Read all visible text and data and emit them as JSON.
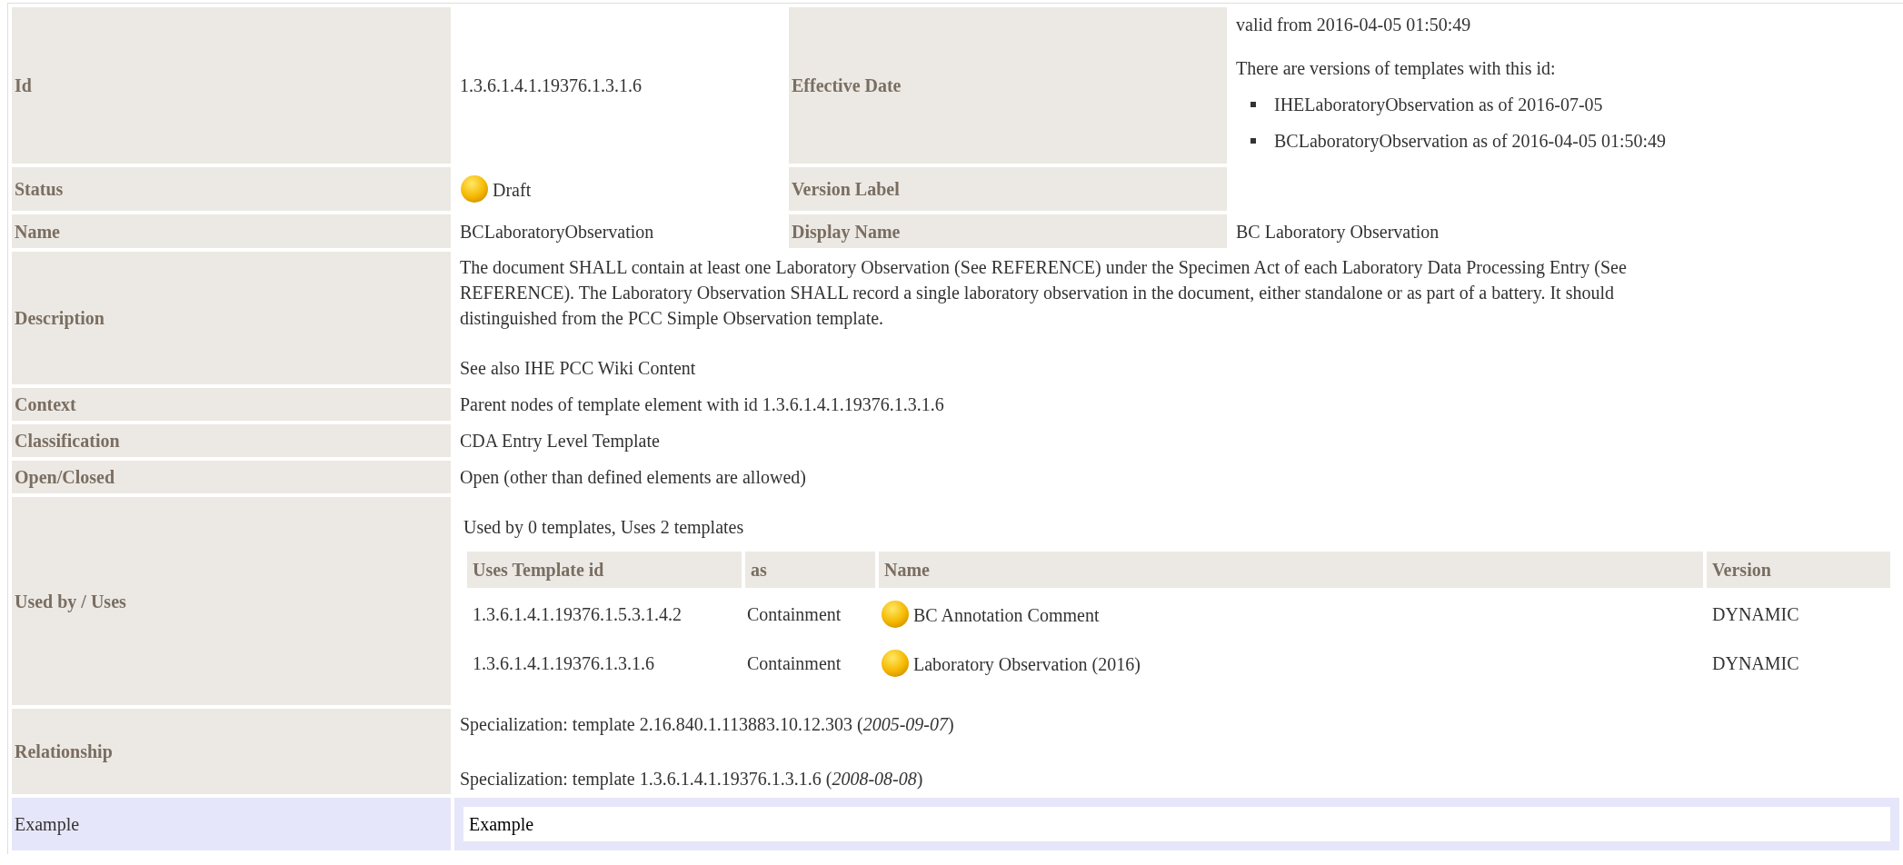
{
  "id": {
    "label": "Id",
    "value": "1.3.6.1.4.1.19376.1.3.1.6"
  },
  "effective_date": {
    "label": "Effective Date",
    "valid_from": "valid from 2016-04-05 01:50:49",
    "versions_intro": "There are versions of templates with this id:",
    "versions": [
      "IHELaboratoryObservation as of 2016-07-05",
      "BCLaboratoryObservation as of 2016-04-05 01:50:49"
    ]
  },
  "status": {
    "label": "Status",
    "value": "Draft",
    "kind": "draft"
  },
  "version_label": {
    "label": "Version Label"
  },
  "name": {
    "label": "Name",
    "value": "BCLaboratoryObservation"
  },
  "display_name": {
    "label": "Display Name",
    "value": "BC Laboratory Observation"
  },
  "description": {
    "label": "Description",
    "lines": [
      "The document SHALL contain at least one Laboratory Observation (See REFERENCE) under the Specimen Act of each Laboratory Data Processing Entry (See",
      "REFERENCE). The Laboratory Observation SHALL record a single laboratory observation in the document, either standalone or as part of a battery. It should",
      "distinguished from the PCC Simple Observation template."
    ],
    "see_also": "See also IHE PCC Wiki Content"
  },
  "rows": [
    {
      "label": "Context",
      "value": "Parent nodes of template element with id 1.3.6.1.4.1.19376.1.3.1.6"
    },
    {
      "label": "Classification",
      "value": "CDA Entry Level Template"
    },
    {
      "label": "Open/Closed",
      "value": "Open (other than defined elements are allowed)"
    }
  ],
  "used_by": {
    "label": "Used by / Uses",
    "summary": "Used by 0 templates, Uses 2 templates",
    "columns": [
      "Uses Template id",
      "as",
      "Name",
      "Version"
    ],
    "rows": [
      {
        "template_id": "1.3.6.1.4.1.19376.1.5.3.1.4.2",
        "as": "Containment",
        "kind": "draft",
        "name": "BC Annotation Comment",
        "version": "DYNAMIC"
      },
      {
        "template_id": "1.3.6.1.4.1.19376.1.3.1.6",
        "as": "Containment",
        "kind": "draft",
        "name": "Laboratory Observation (2016)",
        "version": "DYNAMIC"
      }
    ]
  },
  "relationship": {
    "label": "Relationship",
    "items": [
      "Specialization: template 2.16.840.1.113883.10.12.303 (*2005-09-07*)",
      "Specialization: template 1.3.6.1.4.1.19376.1.3.1.6 (*2008-08-08*)"
    ]
  },
  "example": {
    "label": "Example",
    "value": "Example"
  }
}
